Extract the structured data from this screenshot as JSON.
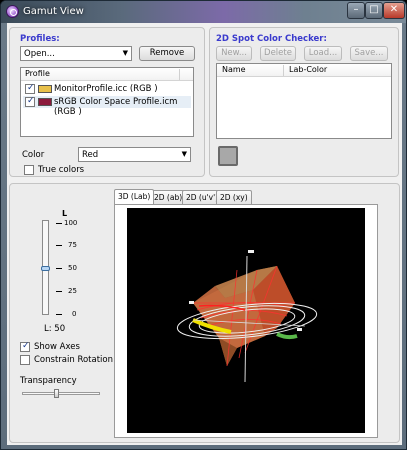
{
  "window": {
    "title": "Gamut View"
  },
  "profiles": {
    "title": "Profiles:",
    "open_value": "Open...",
    "remove_label": "Remove",
    "list_header": "Profile",
    "items": [
      {
        "label": "MonitorProfile.icc (RGB )",
        "checked": true,
        "swatch_color": "#e8c04a"
      },
      {
        "label": "sRGB Color Space Profile.icm (RGB )",
        "checked": true,
        "swatch_color": "#8c1a3c"
      }
    ],
    "color_label": "Color",
    "color_value": "Red",
    "true_colors_label": "True colors"
  },
  "spot_checker": {
    "title": "2D Spot Color Checker:",
    "buttons": {
      "new": "New...",
      "delete": "Delete",
      "load": "Load...",
      "save": "Save..."
    },
    "columns": {
      "name": "Name",
      "lab": "Lab-Color"
    },
    "swatch_color": "#a8a8a8"
  },
  "view": {
    "tabs": [
      "3D (Lab)",
      "2D (ab)",
      "2D (u'v')",
      "2D (xy)"
    ],
    "active_tab": "3D (Lab)"
  },
  "l_slider": {
    "axis_label": "L",
    "ticks": [
      "100",
      "75",
      "50",
      "25",
      "0"
    ],
    "value_label": "L: 50",
    "value": 50
  },
  "options": {
    "show_axes_label": "Show Axes",
    "show_axes_checked": true,
    "constrain_rotation_label": "Constrain Rotation",
    "constrain_rotation_checked": false
  },
  "transparency": {
    "label": "Transparency",
    "value": 0.4
  },
  "colors": {
    "group_title": "#3a3acd",
    "viewport_bg": "#000000"
  }
}
